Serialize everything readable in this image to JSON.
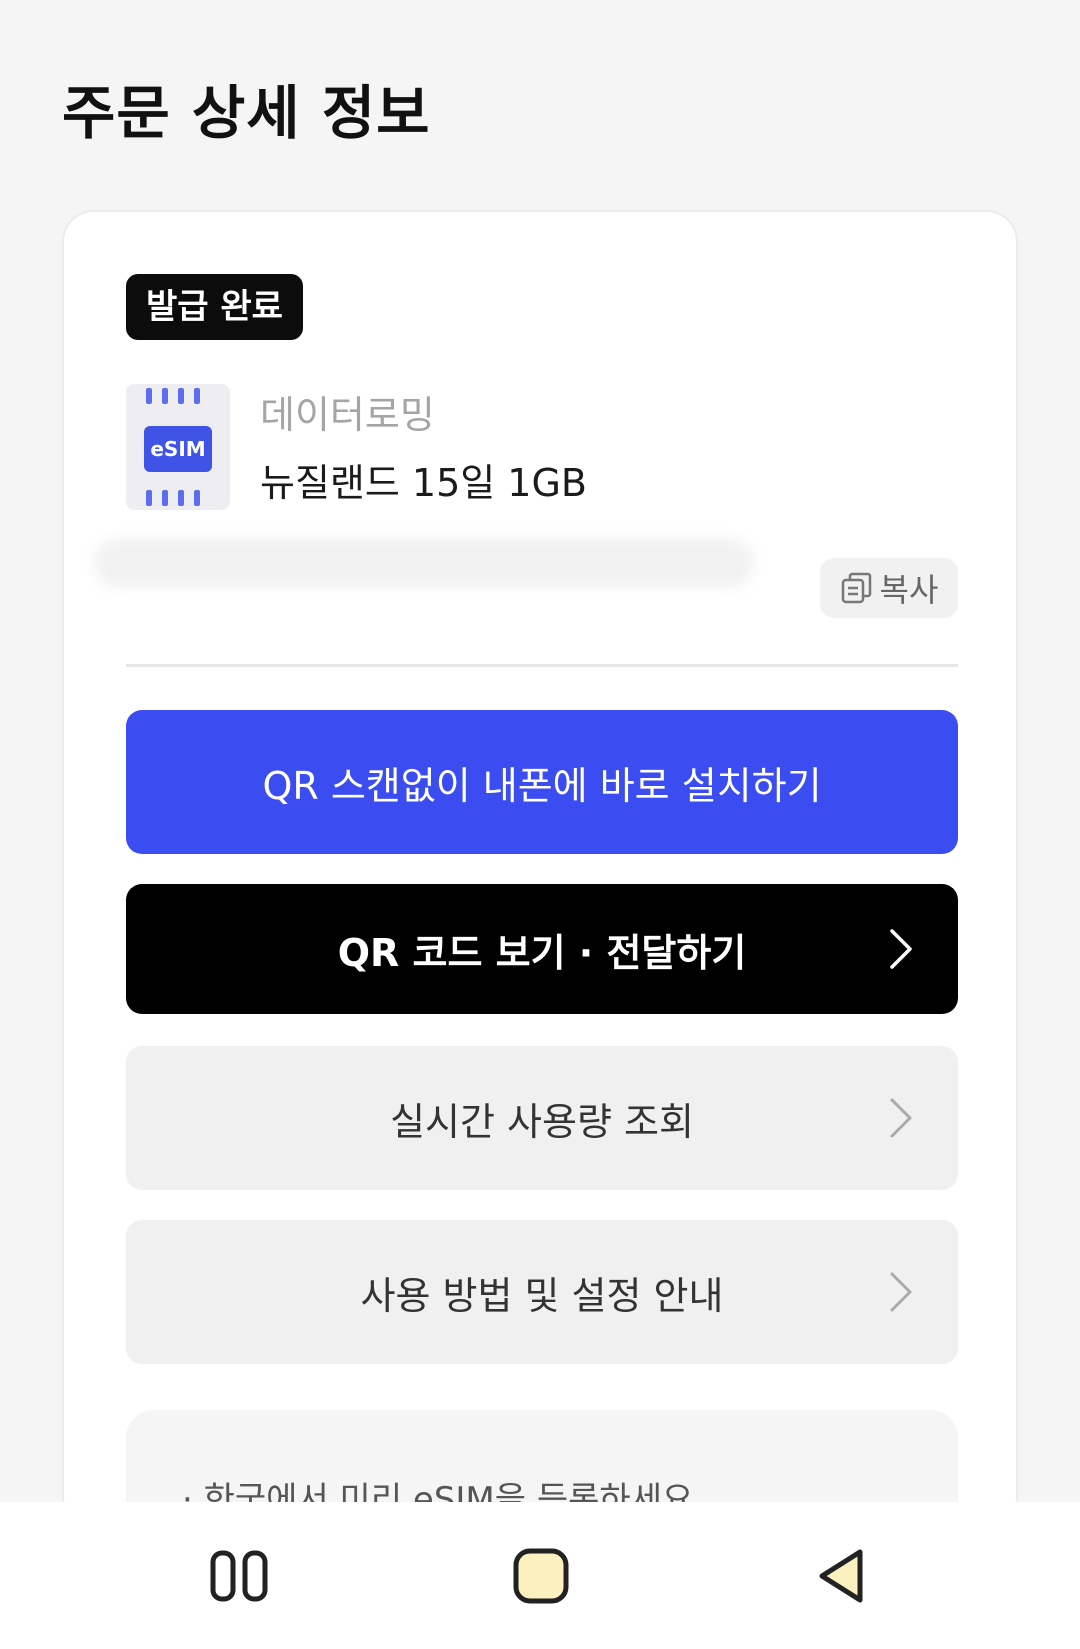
{
  "header": {
    "title": "주문 상세 정보"
  },
  "order": {
    "status_badge": "발급 완료",
    "esim_label": "eSIM",
    "category": "데이터로밍",
    "product_name": "뉴질랜드 15일 1GB",
    "copy_label": "복사"
  },
  "actions": {
    "install_label": "QR 스캔없이 내폰에 바로 설치하기",
    "qr_label": "QR 코드 보기 · 전달하기",
    "usage_label": "실시간 사용량 조회",
    "guide_label": "사용 방법 및 설정 안내"
  },
  "notice": {
    "line1": "· 한국에서 미리 eSIM을 등록하세요."
  },
  "colors": {
    "primary": "#3b4df0",
    "dark": "#000000",
    "secondary_bg": "#f0f0f0",
    "home_icon_fill": "#fdf0c0"
  },
  "icons": {
    "copy": "copy-icon",
    "chevron": "chevron-right-icon",
    "nav_recent": "recent-apps-icon",
    "nav_home": "home-icon",
    "nav_back": "back-icon"
  }
}
